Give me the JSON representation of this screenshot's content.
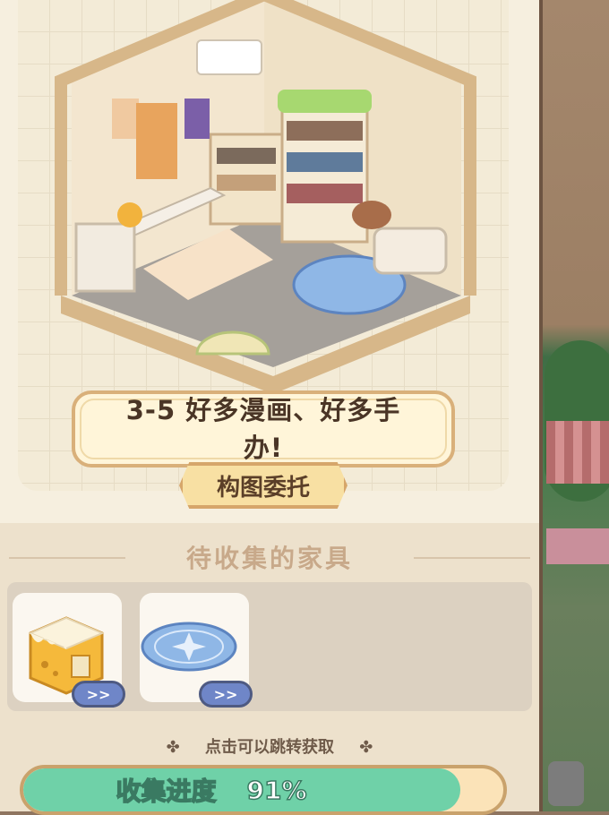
{
  "commission": {
    "title": "3-5 好多漫画、好多手办!",
    "tag": "构图委托"
  },
  "furniture": {
    "section_title": "待收集的家具",
    "items": [
      {
        "name": "yellow-cake-cabinet",
        "go_label": ">>"
      },
      {
        "name": "blue-star-round-rug",
        "go_label": ">>"
      }
    ],
    "hint": "点击可以跳转获取",
    "hint_deco": "✤"
  },
  "progress": {
    "label": "收集进度",
    "value_text": "91%",
    "value": 0.91
  },
  "colors": {
    "accent_green": "#6fd1a8",
    "banner_border": "#d9b07a",
    "button_blue": "#6f86c8"
  }
}
